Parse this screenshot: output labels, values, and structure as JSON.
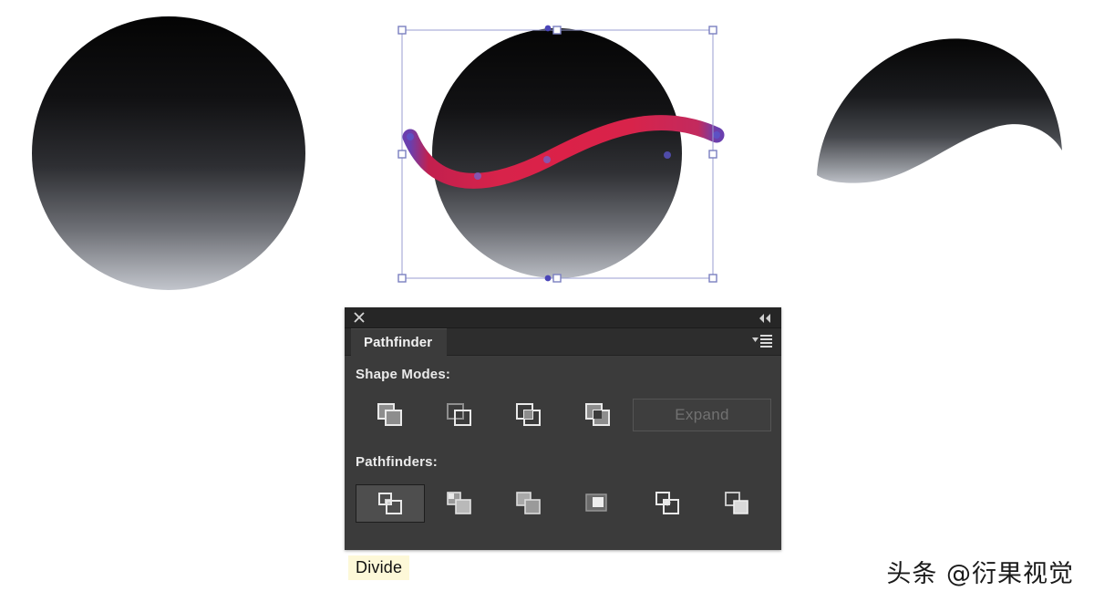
{
  "canvas": {
    "background": "#ffffff",
    "artwork": {
      "left_shape_name": "gradient-circle-original",
      "middle_shape_name": "gradient-circle-with-wave-path",
      "right_shape_name": "divided-crescent-result",
      "gradient_top": "#050505",
      "gradient_bottom": "#b9bcc4",
      "curve_color": "#d8234a",
      "curve_accent_color": "#5a55c8",
      "selection_color": "#8f93c8"
    }
  },
  "panel": {
    "title_tab": "Pathfinder",
    "close_icon": "close-icon",
    "collapse_icon": "double-chevron-left-icon",
    "menu_icon": "panel-menu-icon",
    "shape_modes": {
      "label": "Shape Modes:",
      "buttons": [
        {
          "name": "unite",
          "label": "Unite",
          "active": false
        },
        {
          "name": "minus-front",
          "label": "Minus Front",
          "active": false
        },
        {
          "name": "intersect",
          "label": "Intersect",
          "active": false
        },
        {
          "name": "exclude",
          "label": "Exclude",
          "active": false
        }
      ],
      "expand_label": "Expand",
      "expand_enabled": false
    },
    "pathfinders": {
      "label": "Pathfinders:",
      "buttons": [
        {
          "name": "divide",
          "label": "Divide",
          "active": true
        },
        {
          "name": "trim",
          "label": "Trim",
          "active": false
        },
        {
          "name": "merge",
          "label": "Merge",
          "active": false
        },
        {
          "name": "crop",
          "label": "Crop",
          "active": false
        },
        {
          "name": "outline",
          "label": "Outline",
          "active": false
        },
        {
          "name": "minus-back",
          "label": "Minus Back",
          "active": false
        }
      ]
    },
    "colors": {
      "titlebar": "#262626",
      "tabbar": "#2d2d2d",
      "body": "#3b3b3b",
      "active_button": "#4e4e4e",
      "text": "#eaeaea",
      "disabled_text": "#717171"
    }
  },
  "tooltip": {
    "text": "Divide",
    "background": "#fdf8d8",
    "text_color": "#101010"
  },
  "watermark": {
    "text": "头条 @衍果视觉"
  }
}
